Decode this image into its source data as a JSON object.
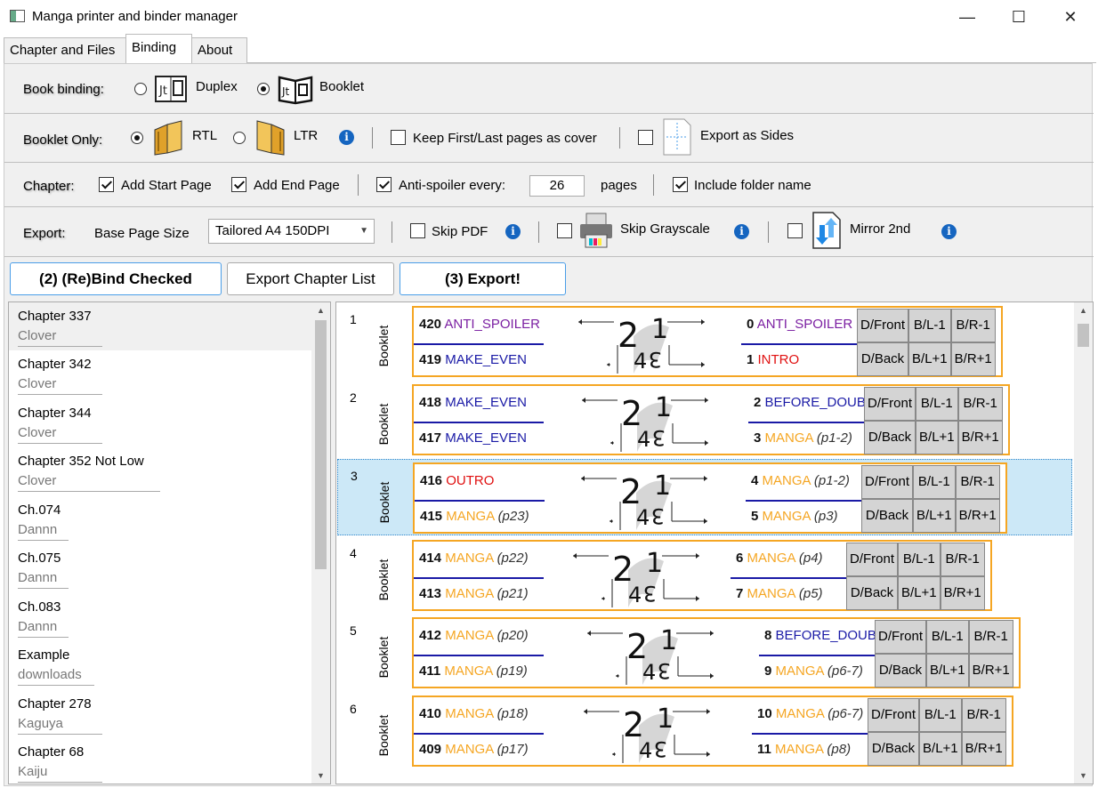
{
  "window": {
    "title": "Manga printer and binder manager",
    "minimize": "—",
    "maximize": "☐",
    "close": "✕"
  },
  "tabs": [
    {
      "label": "Chapter and Files"
    },
    {
      "label": "Binding"
    },
    {
      "label": "About"
    }
  ],
  "binding_row": {
    "label": "Book binding:",
    "duplex": "Duplex",
    "booklet": "Booklet",
    "selected": "Booklet"
  },
  "booklet_row": {
    "label": "Booklet Only:",
    "rtl": "RTL",
    "ltr": "LTR",
    "selected": "RTL",
    "keep_cover": "Keep First/Last pages as cover",
    "export_sides": "Export as Sides"
  },
  "chapter_row": {
    "label": "Chapter:",
    "add_start": "Add Start Page",
    "add_end": "Add End Page",
    "anti_spoiler": "Anti-spoiler every:",
    "anti_spoiler_value": "26",
    "pages": "pages",
    "include_folder": "Include folder name"
  },
  "export_row": {
    "label": "Export:",
    "base_size_label": "Base Page Size",
    "base_size_value": "Tailored A4 150DPI",
    "skip_pdf": "Skip PDF",
    "skip_grayscale": "Skip Grayscale",
    "mirror_2nd": "Mirror 2nd"
  },
  "buttons": {
    "rebind": "(2) (Re)Bind Checked",
    "export_list": "Export Chapter List",
    "export": "(3) Export!"
  },
  "chapters": [
    {
      "name": "Chapter 337",
      "source": "Clover"
    },
    {
      "name": "Chapter 342",
      "source": "Clover"
    },
    {
      "name": "Chapter 344",
      "source": "Clover"
    },
    {
      "name": "Chapter 352 Not Low",
      "source": "Clover"
    },
    {
      "name": "Ch.074",
      "source": "Dannn"
    },
    {
      "name": "Ch.075",
      "source": "Dannn"
    },
    {
      "name": "Ch.083",
      "source": "Dannn"
    },
    {
      "name": "Example",
      "source": "downloads"
    },
    {
      "name": "Chapter 278",
      "source": "Kaguya"
    },
    {
      "name": "Chapter 68",
      "source": "Kaiju"
    }
  ],
  "sheet_cells": {
    "front": "D/Front",
    "back": "D/Back",
    "bl_minus": "B/L-1",
    "br_minus": "B/R-1",
    "bl_plus": "B/L+1",
    "br_plus": "B/R+1"
  },
  "sheets": [
    {
      "index": "1",
      "type": "Booklet",
      "tl": {
        "num": "420",
        "kind": "ANTI_SPOILER",
        "page": ""
      },
      "bl": {
        "num": "419",
        "kind": "MAKE_EVEN",
        "page": ""
      },
      "tr": {
        "num": "0",
        "kind": "ANTI_SPOILER",
        "page": ""
      },
      "br": {
        "num": "1",
        "kind": "INTRO",
        "page": ""
      }
    },
    {
      "index": "2",
      "type": "Booklet",
      "tl": {
        "num": "418",
        "kind": "MAKE_EVEN",
        "page": ""
      },
      "bl": {
        "num": "417",
        "kind": "MAKE_EVEN",
        "page": ""
      },
      "tr": {
        "num": "2",
        "kind": "BEFORE_DOUBLE",
        "page": ""
      },
      "br": {
        "num": "3",
        "kind": "MANGA",
        "page": "(p1-2)"
      }
    },
    {
      "index": "3",
      "type": "Booklet",
      "tl": {
        "num": "416",
        "kind": "OUTRO",
        "page": ""
      },
      "bl": {
        "num": "415",
        "kind": "MANGA",
        "page": "(p23)"
      },
      "tr": {
        "num": "4",
        "kind": "MANGA",
        "page": "(p1-2)"
      },
      "br": {
        "num": "5",
        "kind": "MANGA",
        "page": "(p3)"
      }
    },
    {
      "index": "4",
      "type": "Booklet",
      "tl": {
        "num": "414",
        "kind": "MANGA",
        "page": "(p22)"
      },
      "bl": {
        "num": "413",
        "kind": "MANGA",
        "page": "(p21)"
      },
      "tr": {
        "num": "6",
        "kind": "MANGA",
        "page": "(p4)"
      },
      "br": {
        "num": "7",
        "kind": "MANGA",
        "page": "(p5)"
      }
    },
    {
      "index": "5",
      "type": "Booklet",
      "tl": {
        "num": "412",
        "kind": "MANGA",
        "page": "(p20)"
      },
      "bl": {
        "num": "411",
        "kind": "MANGA",
        "page": "(p19)"
      },
      "tr": {
        "num": "8",
        "kind": "BEFORE_DOUBLE",
        "page": ""
      },
      "br": {
        "num": "9",
        "kind": "MANGA",
        "page": "(p6-7)"
      }
    },
    {
      "index": "6",
      "type": "Booklet",
      "tl": {
        "num": "410",
        "kind": "MANGA",
        "page": "(p18)"
      },
      "bl": {
        "num": "409",
        "kind": "MANGA",
        "page": "(p17)"
      },
      "tr": {
        "num": "10",
        "kind": "MANGA",
        "page": "(p6-7)"
      },
      "br": {
        "num": "11",
        "kind": "MANGA",
        "page": "(p8)"
      }
    }
  ],
  "icons": [
    "duplex-icon",
    "booklet-icon",
    "rtl-book-icon",
    "ltr-book-icon",
    "info-icon",
    "sides-icon",
    "printer-icon",
    "mirror-icon",
    "page-order-icon"
  ],
  "colors": {
    "frame": "#f5a623",
    "selected_row": "#cce8f7",
    "accent": "#4a9ee8",
    "info": "#1565c0"
  }
}
